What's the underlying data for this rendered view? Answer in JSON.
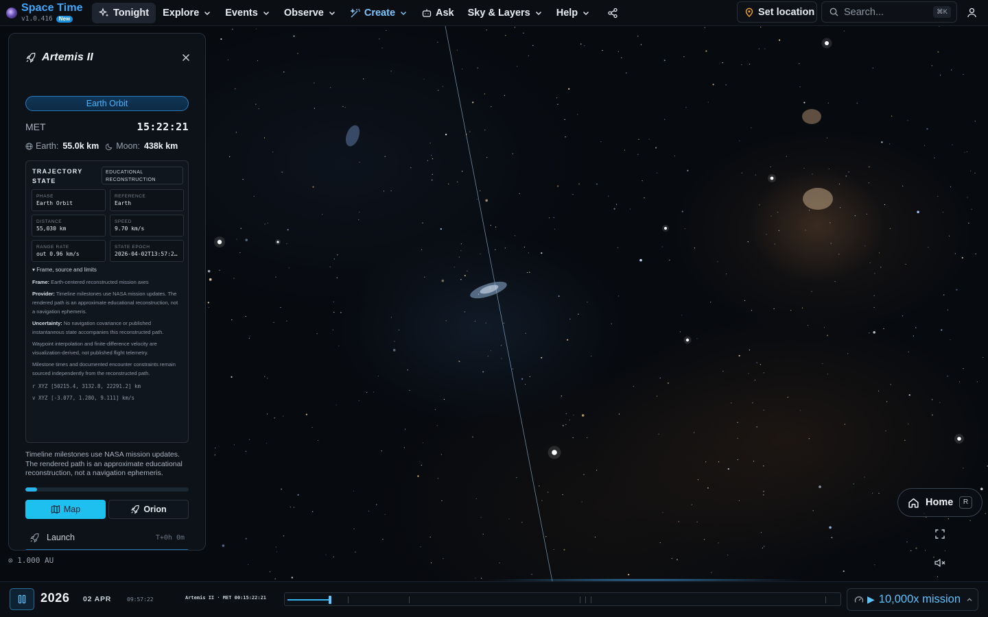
{
  "app": {
    "name": "Space Time",
    "version": "v1.0.416",
    "version_badge": "New"
  },
  "nav": [
    {
      "label": "Tonight",
      "icon": "sparkles-icon",
      "active": true,
      "dropdown": false
    },
    {
      "label": "Explore",
      "dropdown": true
    },
    {
      "label": "Events",
      "dropdown": true
    },
    {
      "label": "Observe",
      "dropdown": true
    },
    {
      "label": "Create",
      "icon": "magic-wand-icon",
      "dropdown": true,
      "accent": "#7cc8ff"
    },
    {
      "label": "Ask",
      "icon": "robot-icon",
      "dropdown": false
    },
    {
      "label": "Sky & Layers",
      "dropdown": true
    },
    {
      "label": "Help",
      "dropdown": true
    }
  ],
  "topbar": {
    "set_location": "Set location",
    "search_placeholder": "Search...",
    "search_shortcut": "⌘K"
  },
  "panel": {
    "title": "Artemis II",
    "phase_pill": "Earth Orbit",
    "met_label": "MET",
    "met_value": "15:22:21",
    "earth_label": "Earth:",
    "earth_value": "55.0k km",
    "moon_label": "Moon:",
    "moon_value": "438k km",
    "trajectory": {
      "title": "TRAJECTORY STATE",
      "badge": "EDUCATIONAL RECONSTRUCTION",
      "cells": [
        {
          "key": "PHASE",
          "value": "Earth Orbit"
        },
        {
          "key": "REFERENCE",
          "value": "Earth"
        },
        {
          "key": "DISTANCE",
          "value": "55,030 km"
        },
        {
          "key": "SPEED",
          "value": "9.70 km/s"
        },
        {
          "key": "RANGE RATE",
          "value": "out 0.96 km/s"
        },
        {
          "key": "STATE EPOCH",
          "value": "2026-04-02T13:57:2…"
        }
      ],
      "frame_toggle": "▾ Frame, source and limits",
      "frame_label": "Frame:",
      "frame_text": "Earth-centered reconstructed mission axes",
      "provider_label": "Provider:",
      "provider_text": "Timeline milestones use NASA mission updates. The rendered path is an approximate educational reconstruction, not a navigation ephemeris.",
      "uncertainty_label": "Uncertainty:",
      "uncertainty_text": "No navigation covariance or published instantaneous state accompanies this reconstructed path.",
      "note_waypoint": "Waypoint interpolation and finite-difference velocity are visualization-derived, not published flight telemetry.",
      "note_milestones": "Milestone times and documented encounter constraints remain sourced independently from the reconstructed path.",
      "r_vec": "r XYZ [50215.4, 3132.8, 22291.2] km",
      "v_vec": "v XYZ [-3.077, 1.280, 9.111] km/s"
    },
    "note": "Timeline milestones use NASA mission updates. The rendered path is an approximate educational reconstruction, not a navigation ephemeris.",
    "progress": 0.07,
    "map_button": "Map",
    "orion_button": "Orion",
    "milestone_name": "Launch",
    "milestone_time": "T+0h 0m"
  },
  "scale_label": "⊙ 1.000 AU",
  "controls": {
    "home_label": "Home",
    "home_key": "R"
  },
  "timeline": {
    "year": "2026",
    "date": "02 APR",
    "clock": "09:57:22",
    "mission_label": "Artemis II · MET 00:15:22:21",
    "position": 0.077,
    "tick_positions": [
      0.11,
      0.22,
      0.53,
      0.54,
      0.55,
      0.975
    ],
    "speed_label": "10,000x mission"
  },
  "colors": {
    "brand": "#3ea9ff",
    "accent": "#1ec0f0",
    "background": "#05070b"
  }
}
